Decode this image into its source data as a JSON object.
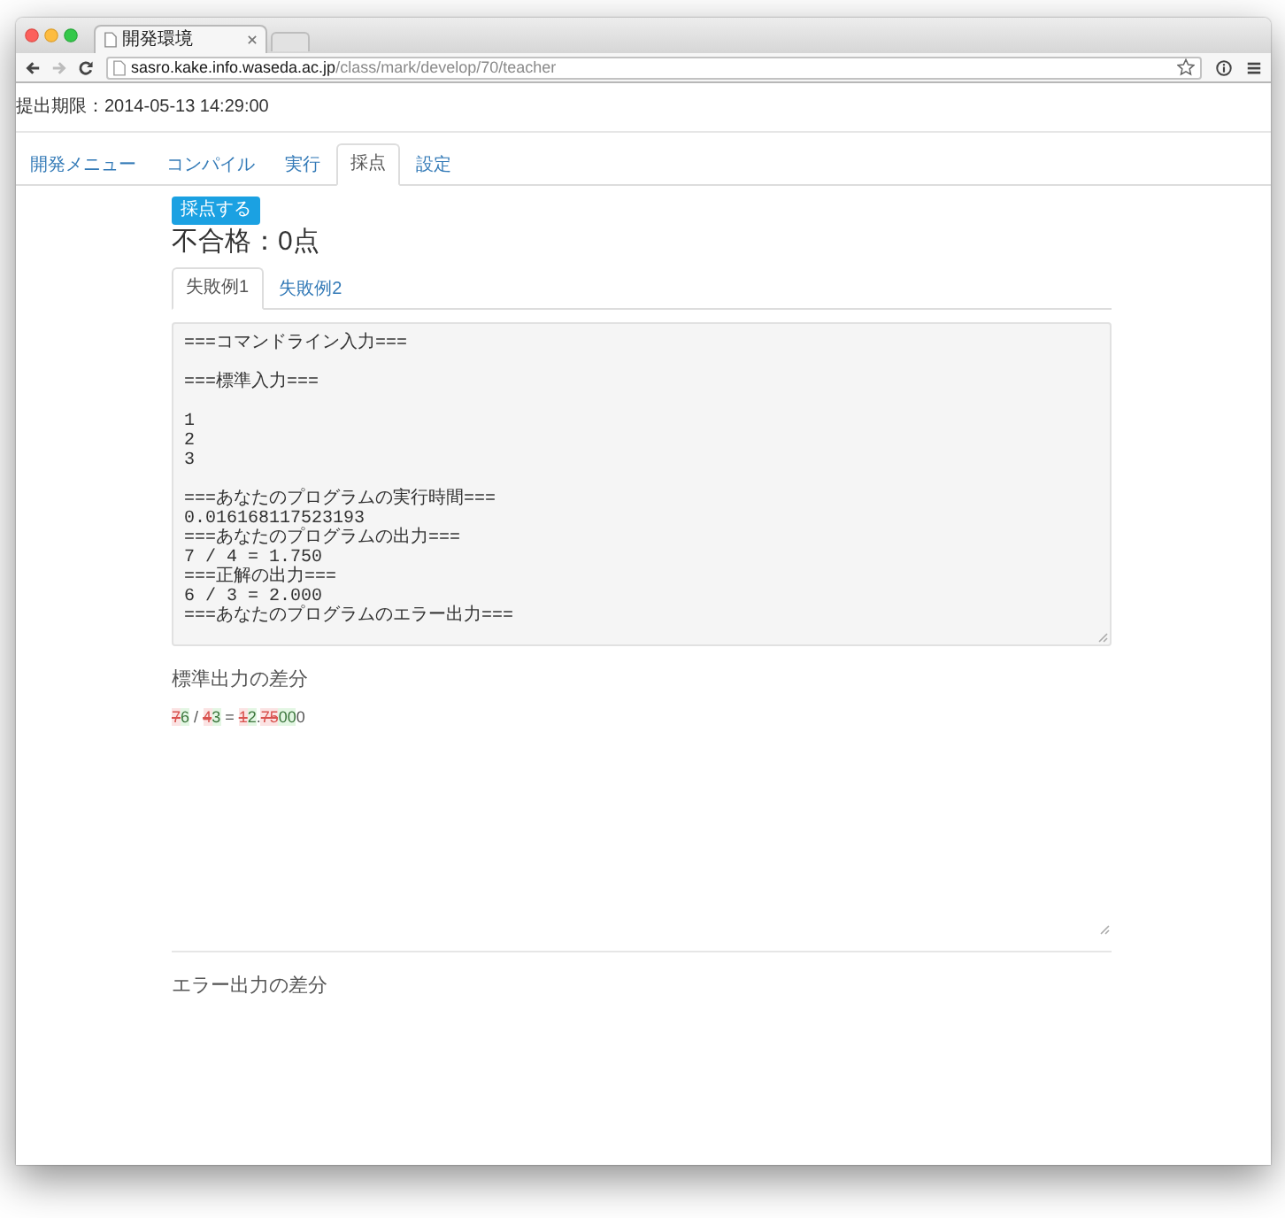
{
  "browser": {
    "tab": {
      "title": "開発環境"
    },
    "nav_buttons": [
      {
        "kind": "back",
        "disabled": false
      },
      {
        "kind": "forward",
        "disabled": true
      },
      {
        "kind": "reload",
        "disabled": false
      }
    ],
    "address_bar": {
      "host": "sasro.kake.info.waseda.ac.jp",
      "path": "/class/mark/develop/70/teacher"
    }
  },
  "deadline": "提出期限：2014-05-13 14:29:00",
  "nav_tabs": [
    {
      "label": "開発メニュー",
      "selected": false
    },
    {
      "label": "コンパイル",
      "selected": false
    },
    {
      "label": "実行",
      "selected": false
    },
    {
      "label": "採点",
      "selected": true
    },
    {
      "label": "設定",
      "selected": false
    }
  ],
  "grade_button": "採点する",
  "result": "不合格：0点",
  "case_tabs": [
    {
      "label": "失敗例1",
      "selected": true
    },
    {
      "label": "失敗例2",
      "selected": false
    }
  ],
  "log_text": "===コマンドライン入力===\n\n===標準入力===\n\n1\n2\n3\n\n===あなたのプログラムの実行時間===\n0.016168117523193\n===あなたのプログラムの出力===\n7 / 4 = 1.750\n===正解の出力===\n6 / 3 = 2.000\n===あなたのプログラムのエラー出力===",
  "stdout_diff": {
    "title": "標準出力の差分",
    "segments": [
      {
        "text": "7",
        "kind": "delete"
      },
      {
        "text": "6",
        "kind": "insert"
      },
      {
        "text": " / ",
        "kind": "equal"
      },
      {
        "text": "4",
        "kind": "delete"
      },
      {
        "text": "3",
        "kind": "insert"
      },
      {
        "text": " = ",
        "kind": "equal"
      },
      {
        "text": "1",
        "kind": "delete"
      },
      {
        "text": "2",
        "kind": "insert"
      },
      {
        "text": ".",
        "kind": "equal"
      },
      {
        "text": "75",
        "kind": "delete"
      },
      {
        "text": "00",
        "kind": "insert"
      },
      {
        "text": "0",
        "kind": "equal"
      }
    ]
  },
  "stderr_diff": {
    "title": "エラー出力の差分"
  }
}
